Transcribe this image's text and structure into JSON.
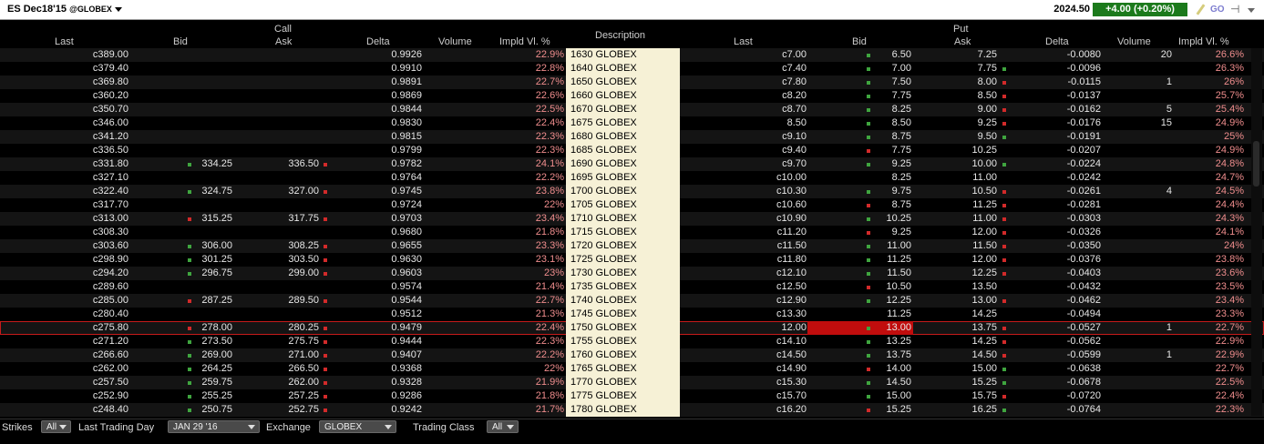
{
  "title": {
    "symbol": "ES Dec18'15",
    "exchange": "@GLOBEX",
    "last": "2024.50",
    "change": "+4.00 (+0.20%)"
  },
  "headers": {
    "call_group": "Call",
    "put_group": "Put",
    "description": "Description",
    "call": {
      "last": "Last",
      "bid": "Bid",
      "ask": "Ask",
      "delta": "Delta",
      "volume": "Volume",
      "iv": "Impld Vl. %"
    },
    "put": {
      "last": "Last",
      "bid": "Bid",
      "ask": "Ask",
      "delta": "Delta",
      "volume": "Volume",
      "iv": "Impld Vl. %"
    }
  },
  "rows": [
    {
      "c_last": "c389.00",
      "c_bid": "",
      "c_ask": "",
      "c_delta": "0.9926",
      "c_vol": "",
      "c_iv": "22.9%",
      "desc": "1630 GLOBEX",
      "p_last": "c7.00",
      "p_bid": "6.50",
      "p_ask": "7.25",
      "p_delta": "-0.0080",
      "p_vol": "20",
      "p_iv": "26.6%",
      "c_bm": "",
      "c_am": "",
      "p_bm": "g",
      "p_am": ""
    },
    {
      "c_last": "c379.40",
      "c_bid": "",
      "c_ask": "",
      "c_delta": "0.9910",
      "c_vol": "",
      "c_iv": "22.8%",
      "desc": "1640 GLOBEX",
      "p_last": "c7.40",
      "p_bid": "7.00",
      "p_ask": "7.75",
      "p_delta": "-0.0096",
      "p_vol": "",
      "p_iv": "26.3%",
      "c_bm": "",
      "c_am": "",
      "p_bm": "g",
      "p_am": "g"
    },
    {
      "c_last": "c369.80",
      "c_bid": "",
      "c_ask": "",
      "c_delta": "0.9891",
      "c_vol": "",
      "c_iv": "22.7%",
      "desc": "1650 GLOBEX",
      "p_last": "c7.80",
      "p_bid": "7.50",
      "p_ask": "8.00",
      "p_delta": "-0.0115",
      "p_vol": "1",
      "p_iv": "26%",
      "c_bm": "",
      "c_am": "",
      "p_bm": "g",
      "p_am": "r"
    },
    {
      "c_last": "c360.20",
      "c_bid": "",
      "c_ask": "",
      "c_delta": "0.9869",
      "c_vol": "",
      "c_iv": "22.6%",
      "desc": "1660 GLOBEX",
      "p_last": "c8.20",
      "p_bid": "7.75",
      "p_ask": "8.50",
      "p_delta": "-0.0137",
      "p_vol": "",
      "p_iv": "25.7%",
      "c_bm": "",
      "c_am": "",
      "p_bm": "g",
      "p_am": "r"
    },
    {
      "c_last": "c350.70",
      "c_bid": "",
      "c_ask": "",
      "c_delta": "0.9844",
      "c_vol": "",
      "c_iv": "22.5%",
      "desc": "1670 GLOBEX",
      "p_last": "c8.70",
      "p_bid": "8.25",
      "p_ask": "9.00",
      "p_delta": "-0.0162",
      "p_vol": "5",
      "p_iv": "25.4%",
      "c_bm": "",
      "c_am": "",
      "p_bm": "g",
      "p_am": "r"
    },
    {
      "c_last": "c346.00",
      "c_bid": "",
      "c_ask": "",
      "c_delta": "0.9830",
      "c_vol": "",
      "c_iv": "22.4%",
      "desc": "1675 GLOBEX",
      "p_last": "8.50",
      "p_bid": "8.50",
      "p_ask": "9.25",
      "p_delta": "-0.0176",
      "p_vol": "15",
      "p_iv": "24.9%",
      "c_bm": "",
      "c_am": "",
      "p_bm": "g",
      "p_am": "r"
    },
    {
      "c_last": "c341.20",
      "c_bid": "",
      "c_ask": "",
      "c_delta": "0.9815",
      "c_vol": "",
      "c_iv": "22.3%",
      "desc": "1680 GLOBEX",
      "p_last": "c9.10",
      "p_bid": "8.75",
      "p_ask": "9.50",
      "p_delta": "-0.0191",
      "p_vol": "",
      "p_iv": "25%",
      "c_bm": "",
      "c_am": "",
      "p_bm": "g",
      "p_am": "g"
    },
    {
      "c_last": "c336.50",
      "c_bid": "",
      "c_ask": "",
      "c_delta": "0.9799",
      "c_vol": "",
      "c_iv": "22.3%",
      "desc": "1685 GLOBEX",
      "p_last": "c9.40",
      "p_bid": "7.75",
      "p_ask": "10.25",
      "p_delta": "-0.0207",
      "p_vol": "",
      "p_iv": "24.9%",
      "c_bm": "",
      "c_am": "",
      "p_bm": "r",
      "p_am": ""
    },
    {
      "c_last": "c331.80",
      "c_bid": "334.25",
      "c_ask": "336.50",
      "c_delta": "0.9782",
      "c_vol": "",
      "c_iv": "24.1%",
      "desc": "1690 GLOBEX",
      "p_last": "c9.70",
      "p_bid": "9.25",
      "p_ask": "10.00",
      "p_delta": "-0.0224",
      "p_vol": "",
      "p_iv": "24.8%",
      "c_bm": "g",
      "c_am": "r",
      "p_bm": "g",
      "p_am": "g"
    },
    {
      "c_last": "c327.10",
      "c_bid": "",
      "c_ask": "",
      "c_delta": "0.9764",
      "c_vol": "",
      "c_iv": "22.2%",
      "desc": "1695 GLOBEX",
      "p_last": "c10.00",
      "p_bid": "8.25",
      "p_ask": "11.00",
      "p_delta": "-0.0242",
      "p_vol": "",
      "p_iv": "24.7%",
      "c_bm": "",
      "c_am": "",
      "p_bm": "",
      "p_am": ""
    },
    {
      "c_last": "c322.40",
      "c_bid": "324.75",
      "c_ask": "327.00",
      "c_delta": "0.9745",
      "c_vol": "",
      "c_iv": "23.8%",
      "desc": "1700 GLOBEX",
      "p_last": "c10.30",
      "p_bid": "9.75",
      "p_ask": "10.50",
      "p_delta": "-0.0261",
      "p_vol": "4",
      "p_iv": "24.5%",
      "c_bm": "g",
      "c_am": "r",
      "p_bm": "g",
      "p_am": "r"
    },
    {
      "c_last": "c317.70",
      "c_bid": "",
      "c_ask": "",
      "c_delta": "0.9724",
      "c_vol": "",
      "c_iv": "22%",
      "desc": "1705 GLOBEX",
      "p_last": "c10.60",
      "p_bid": "8.75",
      "p_ask": "11.25",
      "p_delta": "-0.0281",
      "p_vol": "",
      "p_iv": "24.4%",
      "c_bm": "",
      "c_am": "",
      "p_bm": "r",
      "p_am": "r"
    },
    {
      "c_last": "c313.00",
      "c_bid": "315.25",
      "c_ask": "317.75",
      "c_delta": "0.9703",
      "c_vol": "",
      "c_iv": "23.4%",
      "desc": "1710 GLOBEX",
      "p_last": "c10.90",
      "p_bid": "10.25",
      "p_ask": "11.00",
      "p_delta": "-0.0303",
      "p_vol": "",
      "p_iv": "24.3%",
      "c_bm": "r",
      "c_am": "r",
      "p_bm": "g",
      "p_am": "r"
    },
    {
      "c_last": "c308.30",
      "c_bid": "",
      "c_ask": "",
      "c_delta": "0.9680",
      "c_vol": "",
      "c_iv": "21.8%",
      "desc": "1715 GLOBEX",
      "p_last": "c11.20",
      "p_bid": "9.25",
      "p_ask": "12.00",
      "p_delta": "-0.0326",
      "p_vol": "",
      "p_iv": "24.1%",
      "c_bm": "",
      "c_am": "",
      "p_bm": "r",
      "p_am": "r"
    },
    {
      "c_last": "c303.60",
      "c_bid": "306.00",
      "c_ask": "308.25",
      "c_delta": "0.9655",
      "c_vol": "",
      "c_iv": "23.3%",
      "desc": "1720 GLOBEX",
      "p_last": "c11.50",
      "p_bid": "11.00",
      "p_ask": "11.50",
      "p_delta": "-0.0350",
      "p_vol": "",
      "p_iv": "24%",
      "c_bm": "g",
      "c_am": "r",
      "p_bm": "g",
      "p_am": "r"
    },
    {
      "c_last": "c298.90",
      "c_bid": "301.25",
      "c_ask": "303.50",
      "c_delta": "0.9630",
      "c_vol": "",
      "c_iv": "23.1%",
      "desc": "1725 GLOBEX",
      "p_last": "c11.80",
      "p_bid": "11.25",
      "p_ask": "12.00",
      "p_delta": "-0.0376",
      "p_vol": "",
      "p_iv": "23.8%",
      "c_bm": "g",
      "c_am": "r",
      "p_bm": "g",
      "p_am": "r"
    },
    {
      "c_last": "c294.20",
      "c_bid": "296.75",
      "c_ask": "299.00",
      "c_delta": "0.9603",
      "c_vol": "",
      "c_iv": "23%",
      "desc": "1730 GLOBEX",
      "p_last": "c12.10",
      "p_bid": "11.50",
      "p_ask": "12.25",
      "p_delta": "-0.0403",
      "p_vol": "",
      "p_iv": "23.6%",
      "c_bm": "g",
      "c_am": "r",
      "p_bm": "g",
      "p_am": "r"
    },
    {
      "c_last": "c289.60",
      "c_bid": "",
      "c_ask": "",
      "c_delta": "0.9574",
      "c_vol": "",
      "c_iv": "21.4%",
      "desc": "1735 GLOBEX",
      "p_last": "c12.50",
      "p_bid": "10.50",
      "p_ask": "13.50",
      "p_delta": "-0.0432",
      "p_vol": "",
      "p_iv": "23.5%",
      "c_bm": "",
      "c_am": "",
      "p_bm": "r",
      "p_am": ""
    },
    {
      "c_last": "c285.00",
      "c_bid": "287.25",
      "c_ask": "289.50",
      "c_delta": "0.9544",
      "c_vol": "",
      "c_iv": "22.7%",
      "desc": "1740 GLOBEX",
      "p_last": "c12.90",
      "p_bid": "12.25",
      "p_ask": "13.00",
      "p_delta": "-0.0462",
      "p_vol": "",
      "p_iv": "23.4%",
      "c_bm": "r",
      "c_am": "r",
      "p_bm": "g",
      "p_am": "r"
    },
    {
      "c_last": "c280.40",
      "c_bid": "",
      "c_ask": "",
      "c_delta": "0.9512",
      "c_vol": "",
      "c_iv": "21.3%",
      "desc": "1745 GLOBEX",
      "p_last": "c13.30",
      "p_bid": "11.25",
      "p_ask": "14.25",
      "p_delta": "-0.0494",
      "p_vol": "",
      "p_iv": "23.3%",
      "c_bm": "",
      "c_am": "",
      "p_bm": "",
      "p_am": ""
    },
    {
      "c_last": "c275.80",
      "c_bid": "278.00",
      "c_ask": "280.25",
      "c_delta": "0.9479",
      "c_vol": "",
      "c_iv": "22.4%",
      "desc": "1750 GLOBEX",
      "p_last": "12.00",
      "p_bid": "13.00",
      "p_ask": "13.75",
      "p_delta": "-0.0527",
      "p_vol": "1",
      "p_iv": "22.7%",
      "c_bm": "r",
      "c_am": "r",
      "p_bm": "g",
      "p_am": "r",
      "hl": true
    },
    {
      "c_last": "c271.20",
      "c_bid": "273.50",
      "c_ask": "275.75",
      "c_delta": "0.9444",
      "c_vol": "",
      "c_iv": "22.3%",
      "desc": "1755 GLOBEX",
      "p_last": "c14.10",
      "p_bid": "13.25",
      "p_ask": "14.25",
      "p_delta": "-0.0562",
      "p_vol": "",
      "p_iv": "22.9%",
      "c_bm": "g",
      "c_am": "r",
      "p_bm": "g",
      "p_am": "r"
    },
    {
      "c_last": "c266.60",
      "c_bid": "269.00",
      "c_ask": "271.00",
      "c_delta": "0.9407",
      "c_vol": "",
      "c_iv": "22.2%",
      "desc": "1760 GLOBEX",
      "p_last": "c14.50",
      "p_bid": "13.75",
      "p_ask": "14.50",
      "p_delta": "-0.0599",
      "p_vol": "1",
      "p_iv": "22.9%",
      "c_bm": "g",
      "c_am": "r",
      "p_bm": "g",
      "p_am": "r"
    },
    {
      "c_last": "c262.00",
      "c_bid": "264.25",
      "c_ask": "266.50",
      "c_delta": "0.9368",
      "c_vol": "",
      "c_iv": "22%",
      "desc": "1765 GLOBEX",
      "p_last": "c14.90",
      "p_bid": "14.00",
      "p_ask": "15.00",
      "p_delta": "-0.0638",
      "p_vol": "",
      "p_iv": "22.7%",
      "c_bm": "g",
      "c_am": "r",
      "p_bm": "r",
      "p_am": "g"
    },
    {
      "c_last": "c257.50",
      "c_bid": "259.75",
      "c_ask": "262.00",
      "c_delta": "0.9328",
      "c_vol": "",
      "c_iv": "21.9%",
      "desc": "1770 GLOBEX",
      "p_last": "c15.30",
      "p_bid": "14.50",
      "p_ask": "15.25",
      "p_delta": "-0.0678",
      "p_vol": "",
      "p_iv": "22.5%",
      "c_bm": "g",
      "c_am": "r",
      "p_bm": "g",
      "p_am": "g"
    },
    {
      "c_last": "c252.90",
      "c_bid": "255.25",
      "c_ask": "257.25",
      "c_delta": "0.9286",
      "c_vol": "",
      "c_iv": "21.8%",
      "desc": "1775 GLOBEX",
      "p_last": "c15.70",
      "p_bid": "15.00",
      "p_ask": "15.75",
      "p_delta": "-0.0720",
      "p_vol": "",
      "p_iv": "22.4%",
      "c_bm": "g",
      "c_am": "r",
      "p_bm": "g",
      "p_am": "r"
    },
    {
      "c_last": "c248.40",
      "c_bid": "250.75",
      "c_ask": "252.75",
      "c_delta": "0.9242",
      "c_vol": "",
      "c_iv": "21.7%",
      "desc": "1780 GLOBEX",
      "p_last": "c16.20",
      "p_bid": "15.25",
      "p_ask": "16.25",
      "p_delta": "-0.0764",
      "p_vol": "",
      "p_iv": "22.3%",
      "c_bm": "g",
      "c_am": "r",
      "p_bm": "r",
      "p_am": "g"
    }
  ],
  "footer": {
    "strikes_label": "Strikes",
    "strikes_value": "All",
    "ltd_label": "Last Trading Day",
    "ltd_value": "JAN 29 '16",
    "exchange_label": "Exchange",
    "exchange_value": "GLOBEX",
    "class_label": "Trading Class",
    "class_value": "All"
  },
  "colors": {
    "up": "#1c7a1c",
    "down": "#c10d0d",
    "desc_bg": "#f6f1d6",
    "iv": "#ef8d8d"
  }
}
